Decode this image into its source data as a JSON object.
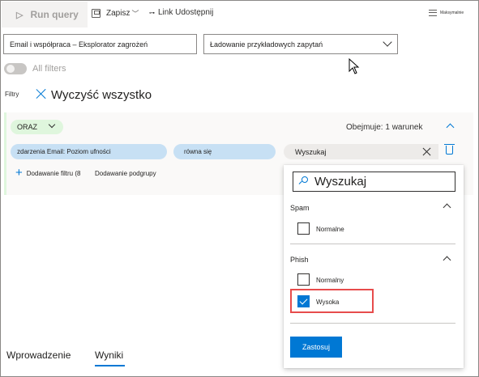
{
  "toolbar": {
    "run_query": "Run query",
    "save": "Zapisz",
    "share": "Link Udostępnij",
    "maximize": "Maksymalnie"
  },
  "selects": {
    "explorer": "Email i współpraca – Eksplorator zagrożeń",
    "queries": "Ładowanie przykładowych zapytań"
  },
  "all_filters": "All filters",
  "filters": {
    "label": "Filtry",
    "clear_all": "Wyczyść wszystko"
  },
  "group": {
    "operator": "ORAZ",
    "applies_to": "Obejmuje: 1 warunek",
    "field": "zdarzenia Email: Poziom ufności",
    "comparison": "równa się",
    "search_value": "Wyszukaj",
    "add_filter": "Dodawanie filtru (8",
    "add_subgroup": "Dodawanie podgrupy"
  },
  "panel": {
    "search_placeholder": "Wyszukaj",
    "sections": [
      {
        "title": "Spam",
        "options": [
          {
            "label": "Normalne",
            "checked": false
          }
        ]
      },
      {
        "title": "Phish",
        "options": [
          {
            "label": "Normalny",
            "checked": false
          },
          {
            "label": "Wysoka",
            "checked": true
          }
        ]
      }
    ],
    "apply": "Zastosuj"
  },
  "tabs": [
    {
      "label": "Wprowadzenie"
    },
    {
      "label": "Wyniki",
      "active": true
    }
  ],
  "colors": {
    "accent": "#0078d4",
    "highlight": "#e74c4c",
    "group_pill": "#dff6dd",
    "value_pill": "#c7e0f4"
  }
}
